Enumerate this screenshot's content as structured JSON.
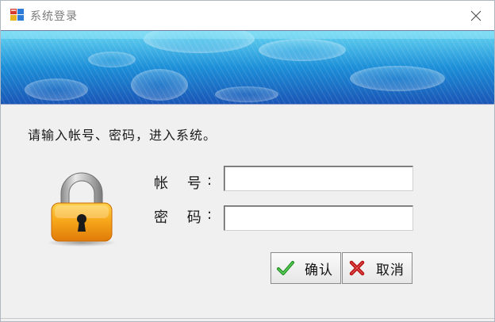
{
  "window": {
    "title": "系统登录"
  },
  "form": {
    "prompt": "请输入帐号、密码，进入系统。",
    "username_label": "帐 号",
    "username_colon": ":",
    "username_value": "",
    "password_label": "密 码",
    "password_colon": ":",
    "password_value": ""
  },
  "buttons": {
    "ok_label": "确认",
    "cancel_label": "取消"
  },
  "icons": {
    "app": "app-window-icon",
    "close": "close-icon",
    "lock": "padlock-icon",
    "ok": "green-checkmark-icon",
    "cancel": "red-x-icon"
  },
  "colors": {
    "banner_base": "#1f8fd6",
    "banner_light": "#5ad1f2",
    "lock_body": "#f6a51a",
    "check": "#1e8c1e",
    "cross": "#b81414"
  }
}
